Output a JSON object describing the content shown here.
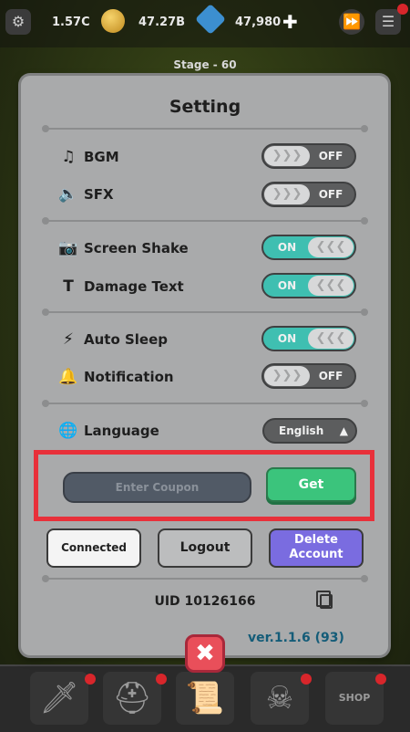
{
  "resources": {
    "stat1": "1.57C",
    "gold": "47.27B",
    "gems": "47,980",
    "plus": "✚"
  },
  "stage": "Stage - 60",
  "settings": {
    "title": "Setting",
    "bgm": {
      "label": "BGM",
      "state": "OFF",
      "icon": "music-note-icon"
    },
    "sfx": {
      "label": "SFX",
      "state": "OFF",
      "icon": "speaker-icon"
    },
    "screen_shake": {
      "label": "Screen Shake",
      "state": "ON",
      "icon": "camera-icon"
    },
    "damage_text": {
      "label": "Damage Text",
      "state": "ON",
      "icon": "damage-text-icon"
    },
    "auto_sleep": {
      "label": "Auto Sleep",
      "state": "ON",
      "icon": "lightning-icon"
    },
    "notification": {
      "label": "Notification",
      "state": "OFF",
      "icon": "bell-icon"
    },
    "language": {
      "label": "Language",
      "value": "English",
      "icon": "globe-icon"
    }
  },
  "coupon": {
    "placeholder": "Enter Coupon",
    "get_label": "Get"
  },
  "account": {
    "connected_label": "Connected",
    "logout_label": "Logout",
    "delete_label": "Delete Account"
  },
  "uid": "UID 10126166",
  "version": "ver.1.1.6 (93)",
  "bottom_nav": {
    "shop": "SHOP"
  },
  "colors": {
    "toggle_on": "#3fbfb1",
    "get_button": "#3bc47c",
    "delete_button": "#7a6ce0",
    "highlight": "#e8303a",
    "close_button": "#e94f5a"
  }
}
